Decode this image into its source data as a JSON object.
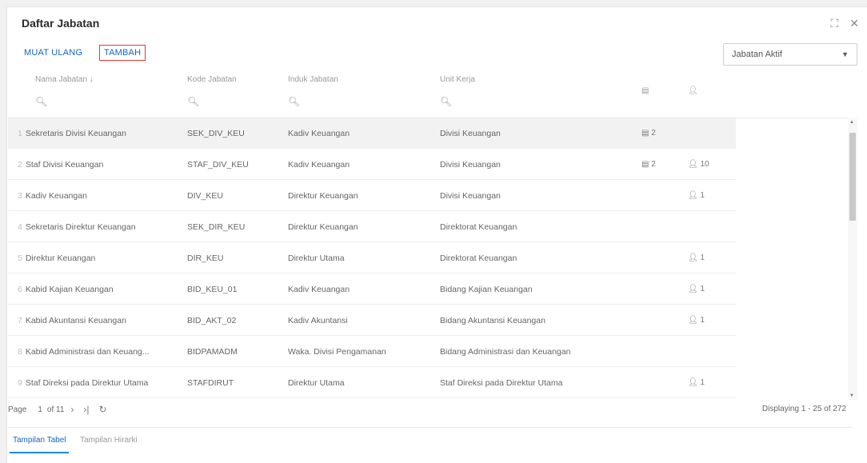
{
  "window": {
    "title": "Daftar Jabatan",
    "expand_icon": "expand-icon",
    "close_icon": "close-icon"
  },
  "toolbar": {
    "reload_label": "MUAT ULANG",
    "add_label": "TAMBAH",
    "filter_value": "Jabatan Aktif"
  },
  "columns": {
    "name": "Nama Jabatan ↓",
    "code": "Kode Jabatan",
    "parent": "Induk Jabatan",
    "unit": "Unit Kerja",
    "sub_icon": "building-icon",
    "user_icon": "person-icon"
  },
  "rows": [
    {
      "num": "1",
      "name": "Sekretaris Divisi Keuangan",
      "code": "SEK_DIV_KEU",
      "parent": "Kadiv Keuangan",
      "unit": "Divisi Keuangan",
      "sub": "2",
      "users": ""
    },
    {
      "num": "2",
      "name": "Staf Divisi Keuangan",
      "code": "STAF_DIV_KEU",
      "parent": "Kadiv Keuangan",
      "unit": "Divisi Keuangan",
      "sub": "2",
      "users": "10"
    },
    {
      "num": "3",
      "name": "Kadiv Keuangan",
      "code": "DIV_KEU",
      "parent": "Direktur Keuangan",
      "unit": "Divisi Keuangan",
      "sub": "",
      "users": "1"
    },
    {
      "num": "4",
      "name": "Sekretaris Direktur Keuangan",
      "code": "SEK_DIR_KEU",
      "parent": "Direktur Keuangan",
      "unit": "Direktorat Keuangan",
      "sub": "",
      "users": ""
    },
    {
      "num": "5",
      "name": "Direktur Keuangan",
      "code": "DIR_KEU",
      "parent": "Direktur Utama",
      "unit": "Direktorat Keuangan",
      "sub": "",
      "users": "1"
    },
    {
      "num": "6",
      "name": "Kabid Kajian Keuangan",
      "code": "BID_KEU_01",
      "parent": "Kadiv Keuangan",
      "unit": "Bidang Kajian Keuangan",
      "sub": "",
      "users": "1"
    },
    {
      "num": "7",
      "name": "Kabid Akuntansi Keuangan",
      "code": "BID_AKT_02",
      "parent": "Kadiv Akuntansi",
      "unit": "Bidang Akuntansi Keuangan",
      "sub": "",
      "users": "1"
    },
    {
      "num": "8",
      "name": "Kabid Administrasi dan Keuang...",
      "code": "BIDPAMADM",
      "parent": "Waka. Divisi Pengamanan",
      "unit": "Bidang Administrasi dan Keuangan",
      "sub": "",
      "users": ""
    },
    {
      "num": "9",
      "name": "Staf Direksi pada Direktur Utama",
      "code": "STAFDIRUT",
      "parent": "Direktur Utama",
      "unit": "Staf Direksi pada Direktur Utama",
      "sub": "",
      "users": "1"
    }
  ],
  "pager": {
    "page_label": "Page",
    "page_value": "1",
    "of_label": "of 11",
    "display": "Displaying 1 - 25 of 272"
  },
  "tabs": {
    "table": "Tampilan Tabel",
    "hierarchy": "Tampilan Hirarki"
  }
}
